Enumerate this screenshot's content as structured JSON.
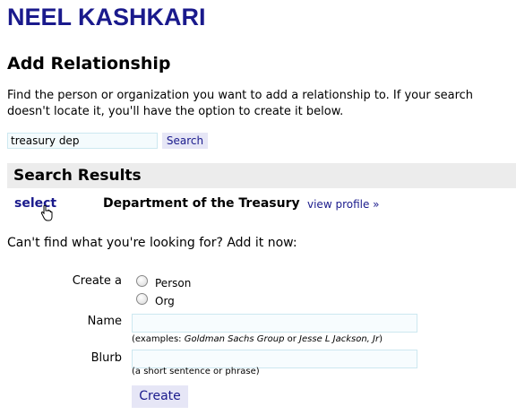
{
  "header": {
    "title": "NEEL KASHKARI"
  },
  "section": {
    "title": "Add Relationship"
  },
  "intro": {
    "text": "Find the person or organization you want to add a relationship to. If your search doesn't locate it, you'll have the option to create it below."
  },
  "search": {
    "value": "treasury dep",
    "button_label": "Search"
  },
  "results": {
    "header": "Search Results",
    "items": [
      {
        "select_label": "select",
        "name": "Department of the Treasury",
        "profile_link": "view profile »"
      }
    ]
  },
  "add_form": {
    "prompt": "Can't find what you're looking for? Add it now:",
    "create_a_label": "Create a",
    "type_options": [
      "Person",
      "Org"
    ],
    "name_label": "Name",
    "name_value": "",
    "name_hint_prefix": "(examples: ",
    "name_hint_example1": "Goldman Sachs Group",
    "name_hint_or": " or ",
    "name_hint_example2": "Jesse L Jackson, Jr",
    "name_hint_suffix": ")",
    "blurb_label": "Blurb",
    "blurb_value": "",
    "blurb_hint": "(a short sentence or phrase)",
    "create_button": "Create"
  },
  "colors": {
    "accent": "#1a1a8c",
    "results_header_bg": "#ececec",
    "button_bg": "#e6e6f6",
    "field_border": "#cde8f0"
  },
  "icons": {
    "cursor": "hand-pointer-icon"
  }
}
